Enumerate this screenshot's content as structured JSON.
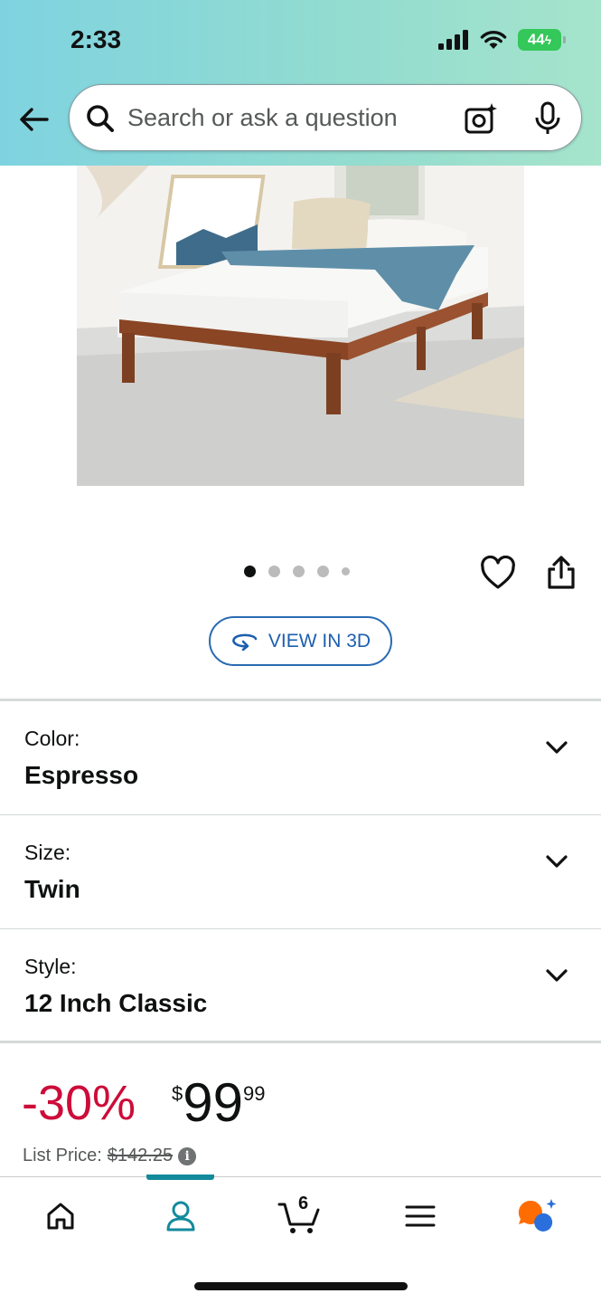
{
  "status_bar": {
    "time": "2:33",
    "battery": "44"
  },
  "search": {
    "placeholder": "Search or ask a question"
  },
  "product": {
    "image_count": 5,
    "active_image_index": 0,
    "view_3d_label": "VIEW IN 3D"
  },
  "variations": [
    {
      "label": "Color:",
      "value": "Espresso"
    },
    {
      "label": "Size:",
      "value": "Twin"
    },
    {
      "label": "Style:",
      "value": "12 Inch Classic"
    }
  ],
  "price": {
    "discount": "-30%",
    "currency_symbol": "$",
    "whole": "99",
    "fraction": "99",
    "list_price_label": "List Price:",
    "list_price": "$142.25"
  },
  "bottom_nav": {
    "items": [
      "home-icon",
      "account-icon",
      "cart-icon",
      "menu-icon",
      "rufus-icon"
    ],
    "active": "account-icon",
    "cart_count": "6"
  },
  "colors": {
    "header_start": "#7fd3e0",
    "header_end": "#a6e4cc",
    "discount_red": "#cc0c39",
    "link_blue": "#1d5fae",
    "nav_active": "#138a9c"
  }
}
